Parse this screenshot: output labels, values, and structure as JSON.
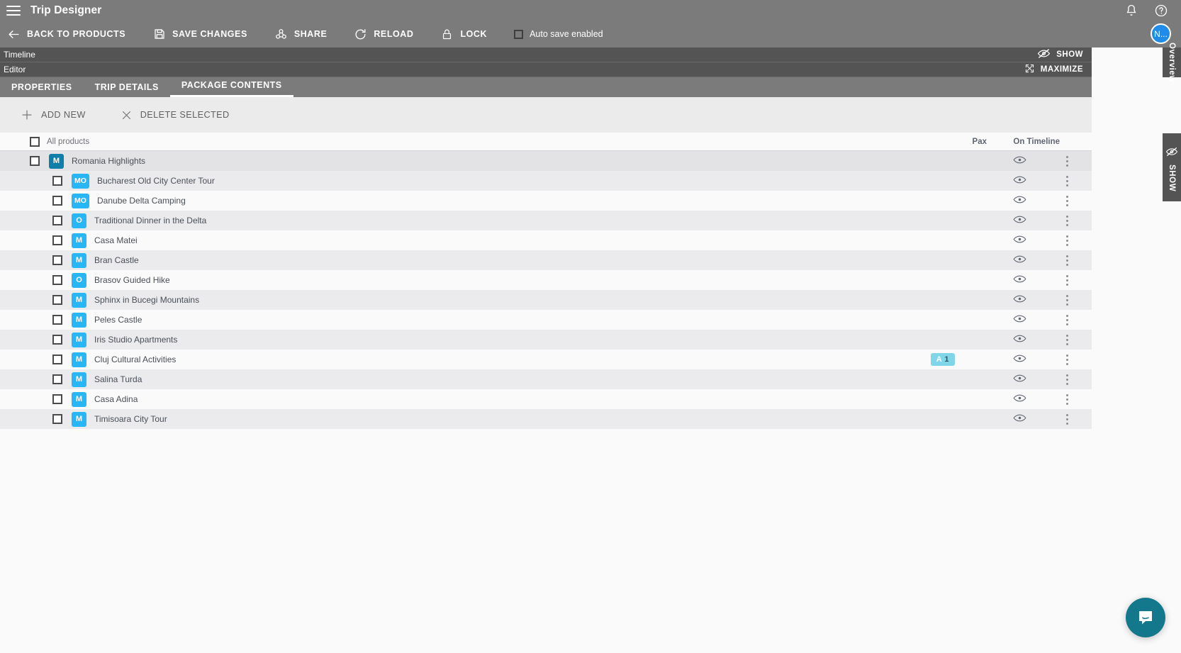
{
  "appbar": {
    "menu_icon": "hamburger-icon",
    "title": "Trip Designer",
    "bell_icon": "bell-icon",
    "help_icon": "help-icon"
  },
  "toolbar": {
    "back_label": "BACK TO PRODUCTS",
    "save_label": "SAVE CHANGES",
    "share_label": "SHARE",
    "reload_label": "RELOAD",
    "lock_label": "LOCK",
    "autosave_label": "Auto save enabled",
    "autosave_checked": false,
    "avatar_label": "N..."
  },
  "panels": {
    "timeline": {
      "title": "Timeline",
      "action": "SHOW",
      "action_icon": "eye-off-icon"
    },
    "editor": {
      "title": "Editor",
      "action": "MAXIMIZE",
      "action_icon": "maximize-icon"
    }
  },
  "rails": {
    "overview": "Overview",
    "show": "SHOW"
  },
  "tabs": [
    {
      "label": "PROPERTIES",
      "active": false
    },
    {
      "label": "TRIP DETAILS",
      "active": false
    },
    {
      "label": "PACKAGE CONTENTS",
      "active": true
    }
  ],
  "actions": {
    "add_new": "ADD NEW",
    "delete_selected": "DELETE SELECTED"
  },
  "table": {
    "select_all_label": "All products",
    "columns": {
      "pax": "Pax",
      "on_timeline": "On Timeline"
    },
    "rows": [
      {
        "name": "Romania Highlights",
        "badge": "M",
        "badge_color": "#0f7faa",
        "level": "group",
        "pax": "",
        "eye": true
      },
      {
        "name": "Bucharest Old City Center Tour",
        "badge": "MO",
        "badge_color": "#29b6f6",
        "level": "child",
        "pax": "",
        "eye": true
      },
      {
        "name": "Danube Delta Camping",
        "badge": "MO",
        "badge_color": "#29b6f6",
        "level": "child",
        "pax": "",
        "eye": true
      },
      {
        "name": "Traditional Dinner in the Delta",
        "badge": "O",
        "badge_color": "#29b6f6",
        "level": "child",
        "pax": "",
        "eye": true
      },
      {
        "name": "Casa Matei",
        "badge": "M",
        "badge_color": "#29b6f6",
        "level": "child",
        "pax": "",
        "eye": true
      },
      {
        "name": "Bran Castle",
        "badge": "M",
        "badge_color": "#29b6f6",
        "level": "child",
        "pax": "",
        "eye": true
      },
      {
        "name": "Brasov Guided Hike",
        "badge": "O",
        "badge_color": "#29b6f6",
        "level": "child",
        "pax": "",
        "eye": true
      },
      {
        "name": "Sphinx in Bucegi Mountains",
        "badge": "M",
        "badge_color": "#29b6f6",
        "level": "child",
        "pax": "",
        "eye": true
      },
      {
        "name": "Peles Castle",
        "badge": "M",
        "badge_color": "#29b6f6",
        "level": "child",
        "pax": "",
        "eye": true
      },
      {
        "name": "Iris Studio Apartments",
        "badge": "M",
        "badge_color": "#29b6f6",
        "level": "child",
        "pax": "",
        "eye": true
      },
      {
        "name": "Cluj Cultural Activities",
        "badge": "M",
        "badge_color": "#29b6f6",
        "level": "child",
        "pax": "A 1",
        "eye": true
      },
      {
        "name": "Salina Turda",
        "badge": "M",
        "badge_color": "#29b6f6",
        "level": "child",
        "pax": "",
        "eye": true
      },
      {
        "name": "Casa Adina",
        "badge": "M",
        "badge_color": "#29b6f6",
        "level": "child",
        "pax": "",
        "eye": true
      },
      {
        "name": "Timisoara City Tour",
        "badge": "M",
        "badge_color": "#29b6f6",
        "level": "child",
        "pax": "",
        "eye": true
      }
    ]
  },
  "chat": {
    "icon": "chat-bubble-icon"
  },
  "colors": {
    "appbar": "#7b7b7b",
    "panelbar": "#545454",
    "accent_blue": "#29b6f6",
    "group_badge": "#0f7faa",
    "pax_badge": "#7fd6e8",
    "chat": "#14788c",
    "avatar": "#1e8ce8"
  }
}
